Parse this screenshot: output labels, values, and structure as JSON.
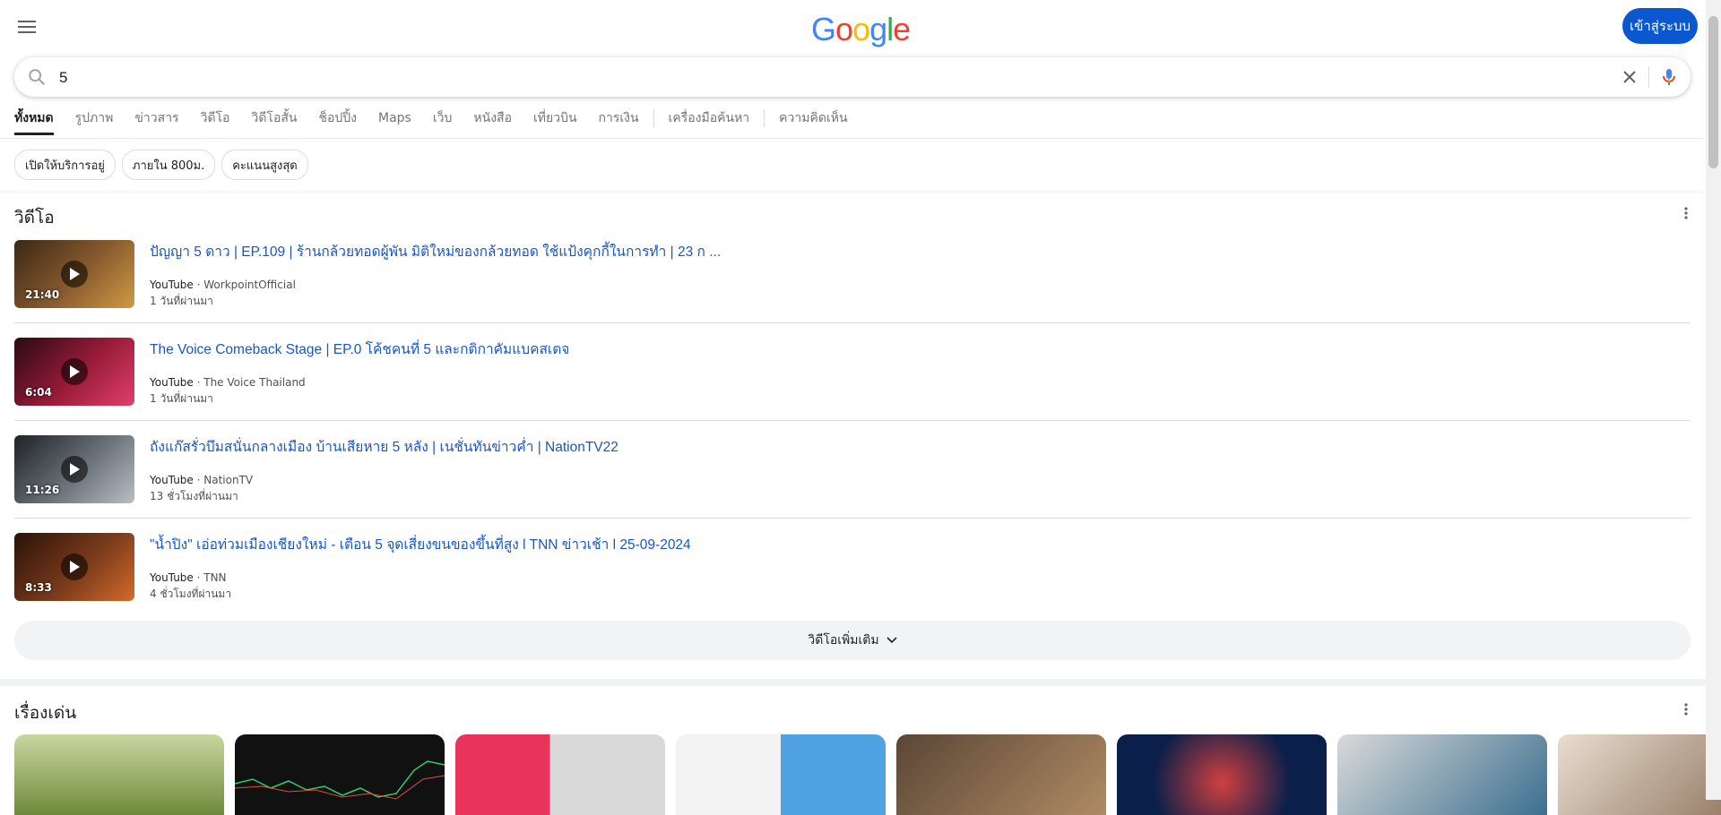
{
  "header": {
    "logo": "Google",
    "signin_label": "เข้าสู่ระบบ"
  },
  "search": {
    "query": "5"
  },
  "tabs": [
    {
      "label": "ทั้งหมด",
      "active": true
    },
    {
      "label": "รูปภาพ"
    },
    {
      "label": "ข่าวสาร"
    },
    {
      "label": "วิดีโอ"
    },
    {
      "label": "วิดีโอสั้น"
    },
    {
      "label": "ช็อปปิ้ง"
    },
    {
      "label": "Maps"
    },
    {
      "label": "เว็บ"
    },
    {
      "label": "หนังสือ"
    },
    {
      "label": "เที่ยวบิน"
    },
    {
      "label": "การเงิน"
    },
    {
      "label": "เครื่องมือค้นหา"
    },
    {
      "label": "ความคิดเห็น"
    }
  ],
  "chips": [
    "เปิดให้บริการอยู่",
    "ภายใน 800ม.",
    "คะแนนสูงสุด"
  ],
  "videos": {
    "title": "วิดีโอ",
    "more_label": "วิดีโอเพิ่มเติม",
    "items": [
      {
        "title": "ปัญญา 5 ดาว | EP.109 | ร้านกล้วยทอดผู้พัน มิติใหม่ของกล้วยทอด ใช้แป้งคุกกี้ในการทำ | 23 ก ...",
        "source": "YouTube",
        "channel": "WorkpointOfficial",
        "age": "1 วันที่ผ่านมา",
        "duration": "21:40",
        "color": "#6b4a2b"
      },
      {
        "title": "The Voice Comeback Stage | EP.0 โค้ชคนที่ 5 และกติกาคัมแบคสเตจ",
        "source": "YouTube",
        "channel": "The Voice Thailand",
        "age": "1 วันที่ผ่านมา",
        "duration": "6:04",
        "color": "#9b1c3a"
      },
      {
        "title": "ถังแก๊สรั่วบึมสนั่นกลางเมือง บ้านเสียหาย 5 หลัง | เนชั่นทันข่าวค่ำ | NationTV22",
        "source": "YouTube",
        "channel": "NationTV",
        "age": "13 ชั่วโมงที่ผ่านมา",
        "duration": "11:26",
        "color": "#4a4f57"
      },
      {
        "title": "\"น้ำปิง\" เอ่อท่วมเมืองเชียงใหม่ - เตือน 5 จุดเสี่ยงขนของขึ้นที่สูง l TNN ข่าวเช้า l 25-09-2024",
        "source": "YouTube",
        "channel": "TNN",
        "age": "4 ชั่วโมงที่ผ่านมา",
        "duration": "8:33",
        "color": "#7a3b1c"
      }
    ]
  },
  "stories": {
    "title": "เรื่องเด่น",
    "card_colors": [
      "#7d8a3e",
      "#111111",
      "#e8345a",
      "#e9eef2",
      "#a88a6a",
      "#0a1f4a",
      "#3b6f8f",
      "#c9b8a6"
    ]
  }
}
